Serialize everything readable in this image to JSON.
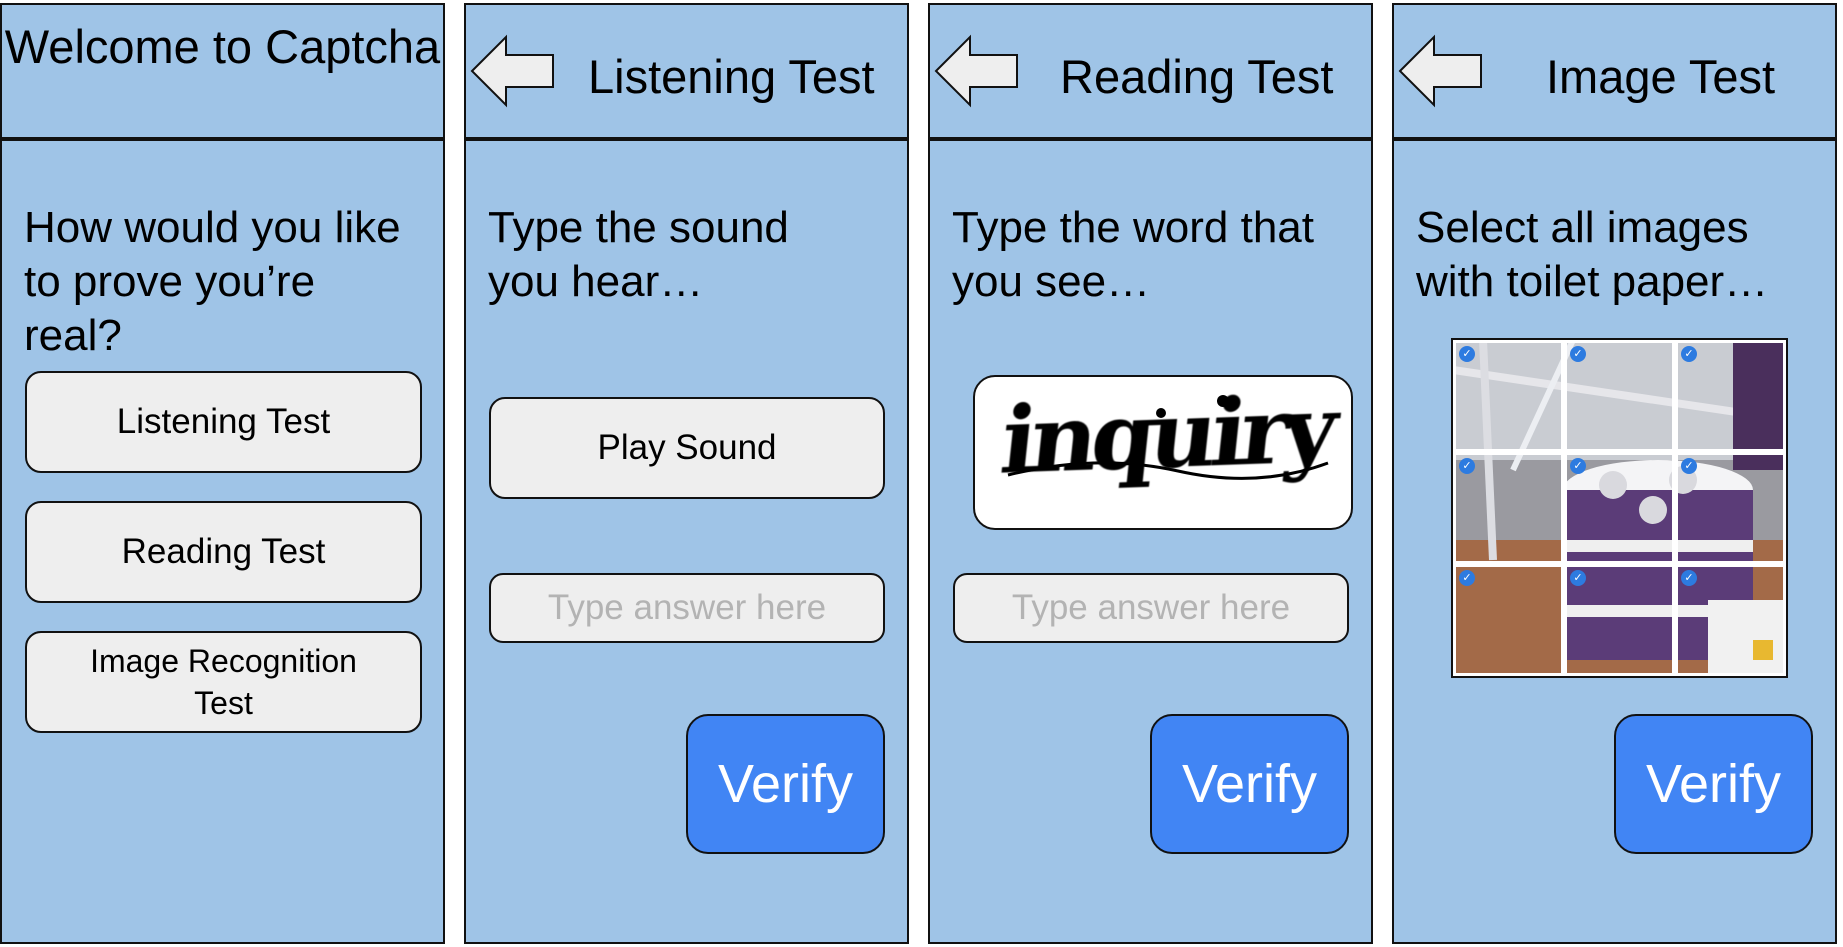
{
  "screens": {
    "welcome": {
      "title": "Welcome to Captcha",
      "prompt": "How would you like to prove you’re real?",
      "options": [
        "Listening Test",
        "Reading Test",
        "Image Recognition Test"
      ]
    },
    "listening": {
      "title": "Listening Test",
      "prompt": "Type the sound you hear…",
      "play_label": "Play Sound",
      "input_placeholder": "Type answer here",
      "verify_label": "Verify"
    },
    "reading": {
      "title": "Reading Test",
      "prompt": "Type the word that you see…",
      "captcha_word": "inquiry",
      "input_placeholder": "Type answer here",
      "verify_label": "Verify"
    },
    "image": {
      "title": "Image Test",
      "prompt": "Select all images with toilet paper…",
      "verify_label": "Verify",
      "grid": {
        "rows": 3,
        "cols": 3,
        "selected": [
          true,
          true,
          true,
          true,
          true,
          true,
          true,
          true,
          true
        ]
      }
    }
  },
  "colors": {
    "screen_bg": "#9fc4e7",
    "button_bg": "#eeeeee",
    "verify_bg": "#4185f4",
    "placeholder": "#b3b3b3"
  },
  "icons": {
    "back": "back-arrow-icon",
    "check": "checkmark-icon"
  }
}
